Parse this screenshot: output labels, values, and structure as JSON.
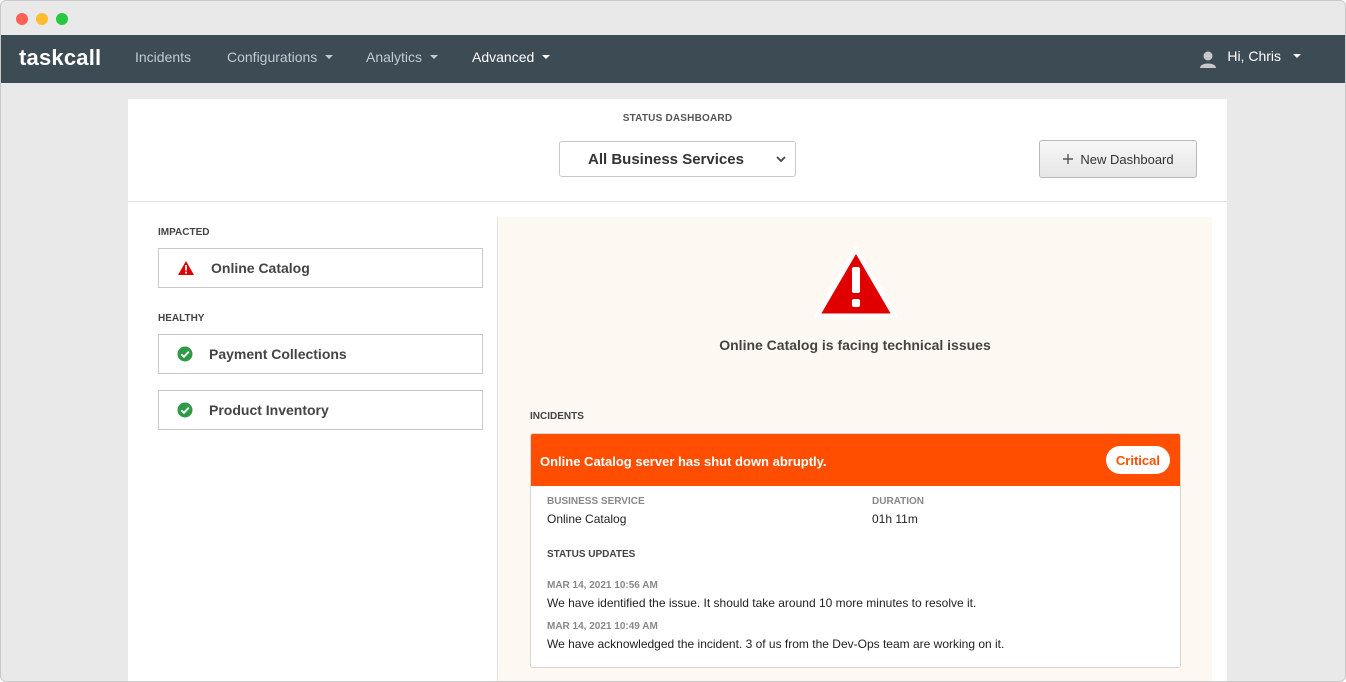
{
  "navbar": {
    "brand": "taskcall",
    "items": [
      {
        "label": "Incidents",
        "has_caret": false
      },
      {
        "label": "Configurations",
        "has_caret": true
      },
      {
        "label": "Analytics",
        "has_caret": true
      },
      {
        "label": "Advanced",
        "has_caret": true
      }
    ],
    "user": "Hi, Chris"
  },
  "dashboard": {
    "label": "STATUS DASHBOARD",
    "selected": "All Business Services",
    "new_button": "New Dashboard"
  },
  "sidebar": {
    "impacted_label": "IMPACTED",
    "impacted": [
      {
        "name": "Online Catalog",
        "icon": "warning-icon"
      }
    ],
    "healthy_label": "HEALTHY",
    "healthy": [
      {
        "name": "Payment Collections",
        "icon": "check-circle-icon"
      },
      {
        "name": "Product Inventory",
        "icon": "check-circle-icon"
      }
    ]
  },
  "panel": {
    "message": "Online Catalog is facing technical issues",
    "incidents_label": "INCIDENTS",
    "incident": {
      "title": "Online Catalog server has shut down abruptly.",
      "severity": "Critical",
      "service_label": "BUSINESS SERVICE",
      "service": "Online Catalog",
      "duration_label": "DURATION",
      "duration": "01h 11m",
      "updates_label": "STATUS UPDATES",
      "updates": [
        {
          "time": "MAR 14, 2021 10:56 AM",
          "text": "We have identified the issue. It should take around 10 more minutes to resolve it."
        },
        {
          "time": "MAR 14, 2021 10:49 AM",
          "text": "We have acknowledged the incident. 3 of us from the Dev-Ops team are working on it."
        }
      ]
    }
  },
  "colors": {
    "navbar_bg": "#3d4b55",
    "incident_header": "#ff4e00",
    "warning_red": "#e00000",
    "healthy_green": "#2e9a47",
    "panel_bg": "#fdf8f1"
  }
}
